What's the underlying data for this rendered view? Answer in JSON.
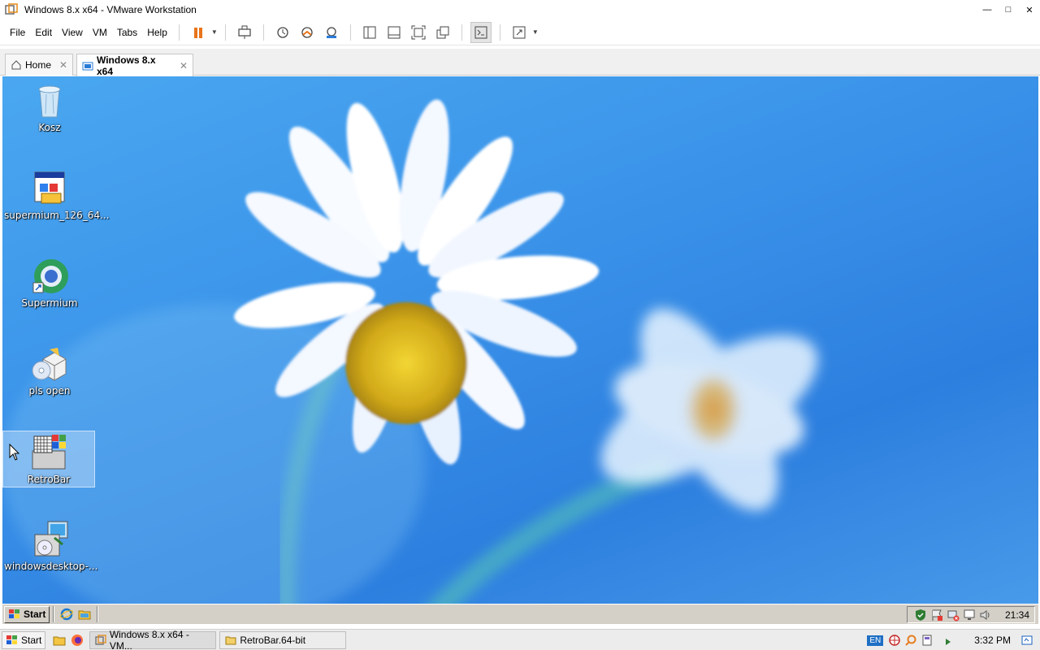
{
  "window": {
    "title": "Windows 8.x x64 - VMware Workstation",
    "controls": {
      "minimize": "—",
      "maximize": "□",
      "close": "✕"
    }
  },
  "menu": [
    "File",
    "Edit",
    "View",
    "VM",
    "Tabs",
    "Help"
  ],
  "toolbar": {
    "icons": [
      "pause-icon",
      "send-keys-icon",
      "snapshot-take-icon",
      "snapshot-revert-icon",
      "snapshot-manager-icon",
      "library-icon",
      "thumbnail-bar-icon",
      "full-screen-icon",
      "unity-icon",
      "console-view-icon",
      "stretch-guest-icon"
    ]
  },
  "tabs": [
    {
      "label": "Home",
      "close": "✕"
    },
    {
      "label": "Windows 8.x x64",
      "close": "✕"
    }
  ],
  "desktop": {
    "icons": [
      {
        "label": "Kosz",
        "icon": "recycle-bin-icon"
      },
      {
        "label": "supermium_126_64...",
        "icon": "installer-icon"
      },
      {
        "label": "Supermium",
        "icon": "supermium-browser-icon"
      },
      {
        "label": "pls open",
        "icon": "package-icon"
      },
      {
        "label": "RetroBar",
        "icon": "retrobar-icon"
      },
      {
        "label": "windowsdesktop-...",
        "icon": "setup-icon"
      }
    ]
  },
  "guest_taskbar": {
    "start_label": "Start",
    "clock": "21:34"
  },
  "host_taskbar": {
    "start_label": "Start",
    "tasks": [
      {
        "label": "Windows 8.x x64 - VM..."
      },
      {
        "label": "RetroBar.64-bit"
      }
    ],
    "lang": "EN",
    "clock": "3:32 PM"
  },
  "colors": {
    "desktop_blue": "#3c95ea",
    "classic_gray": "#d4d0c8",
    "pause_orange": "#e8741a"
  }
}
